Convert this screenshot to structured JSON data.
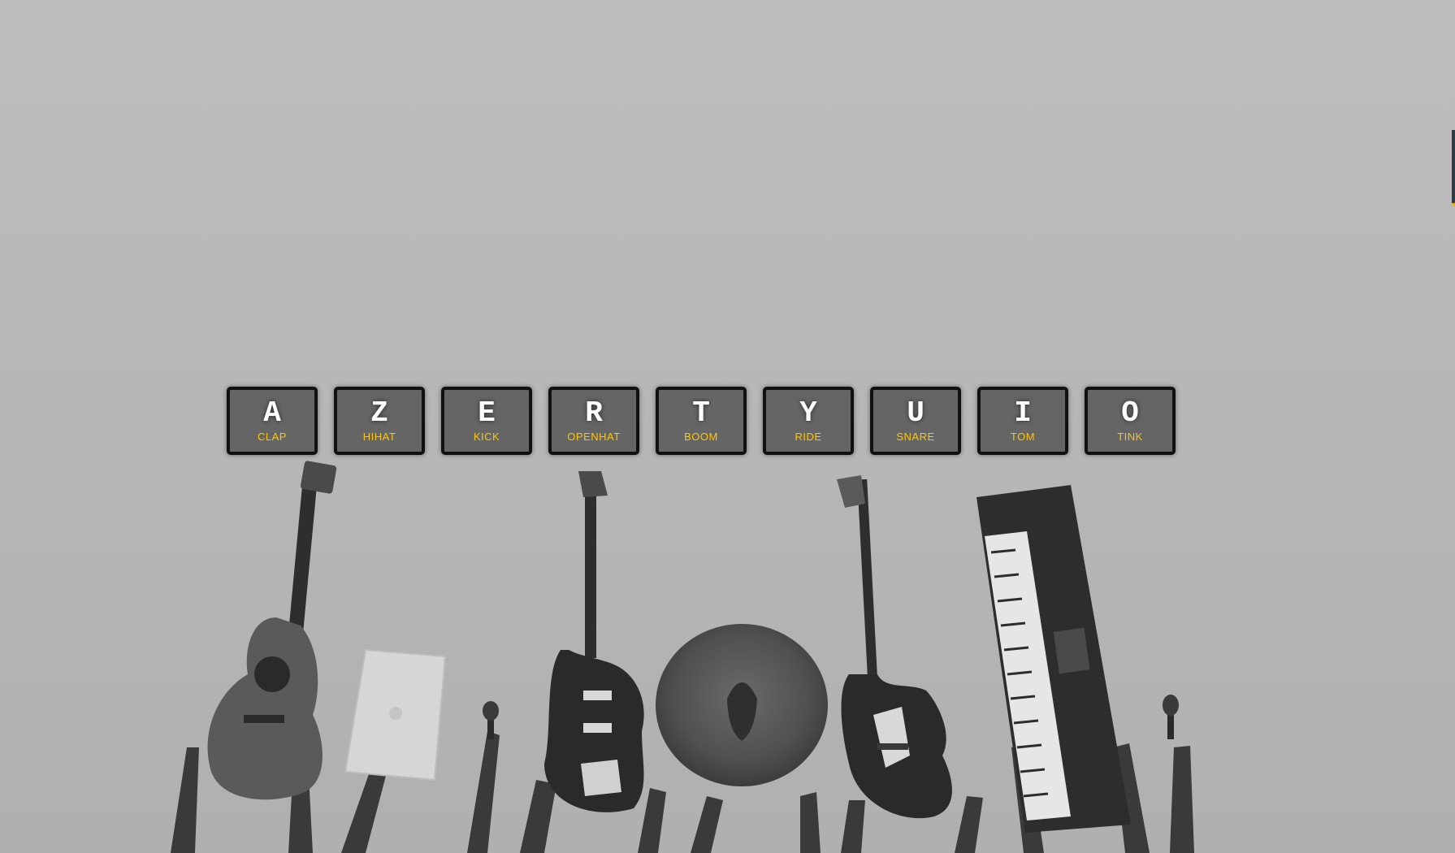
{
  "keys": [
    {
      "letter": "A",
      "sound": "CLAP"
    },
    {
      "letter": "Z",
      "sound": "HIHAT"
    },
    {
      "letter": "E",
      "sound": "KICK"
    },
    {
      "letter": "R",
      "sound": "OPENHAT"
    },
    {
      "letter": "T",
      "sound": "BOOM"
    },
    {
      "letter": "Y",
      "sound": "RIDE"
    },
    {
      "letter": "U",
      "sound": "SNARE"
    },
    {
      "letter": "I",
      "sound": "TOM"
    },
    {
      "letter": "O",
      "sound": "TINK"
    }
  ],
  "colors": {
    "background": "#b7b7b7",
    "key_bg": "#5a5a5a",
    "key_border": "#111111",
    "letter": "#ffffff",
    "sound_label": "#ffc600"
  },
  "illustration": {
    "icons": [
      "acoustic-guitar-icon",
      "laptop-icon",
      "microphone-icon",
      "electric-guitar-icon",
      "cymbal-icon",
      "bass-guitar-icon",
      "keyboard-synth-icon",
      "microphone-icon"
    ]
  }
}
